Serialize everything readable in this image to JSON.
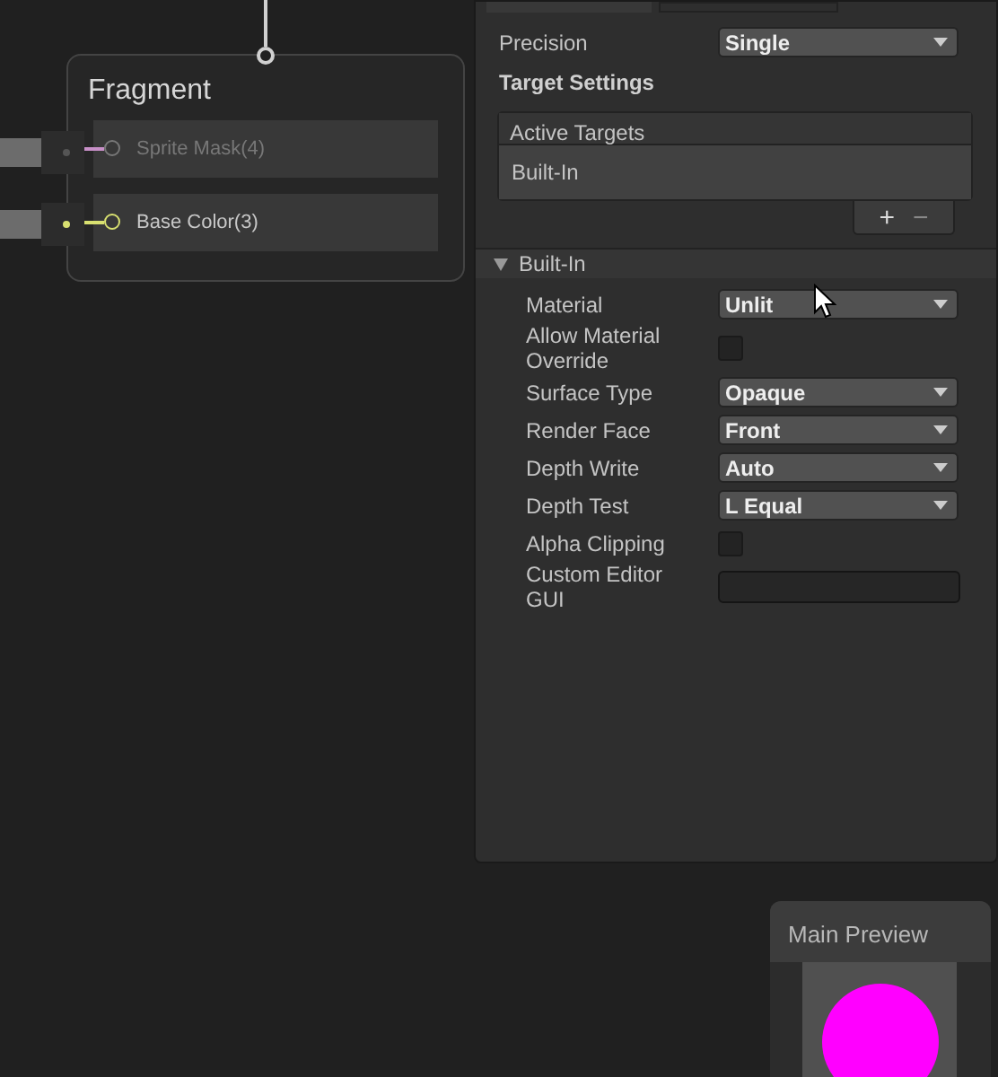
{
  "node": {
    "title": "Fragment",
    "ports": [
      {
        "label": "Sprite Mask(4)",
        "disabled": true,
        "color": "#c890c8"
      },
      {
        "label": "Base Color(3)",
        "disabled": false,
        "color": "#d8e070"
      }
    ]
  },
  "inspector": {
    "precision": {
      "label": "Precision",
      "value": "Single"
    },
    "section_title": "Target Settings",
    "active_targets": {
      "header": "Active Targets",
      "items": [
        "Built-In"
      ],
      "add": "+",
      "remove": "−"
    },
    "built_in": {
      "title": "Built-In",
      "expanded": true,
      "fields": [
        {
          "kind": "dropdown",
          "label": "Material",
          "value": "Unlit"
        },
        {
          "kind": "checkbox",
          "label": "Allow Material Override",
          "checked": false
        },
        {
          "kind": "dropdown",
          "label": "Surface Type",
          "value": "Opaque"
        },
        {
          "kind": "dropdown",
          "label": "Render Face",
          "value": "Front"
        },
        {
          "kind": "dropdown",
          "label": "Depth Write",
          "value": "Auto"
        },
        {
          "kind": "dropdown",
          "label": "Depth Test",
          "value": "L Equal"
        },
        {
          "kind": "checkbox",
          "label": "Alpha Clipping",
          "checked": false
        },
        {
          "kind": "text",
          "label": "Custom Editor GUI"
        }
      ]
    }
  },
  "preview": {
    "title": "Main Preview"
  }
}
